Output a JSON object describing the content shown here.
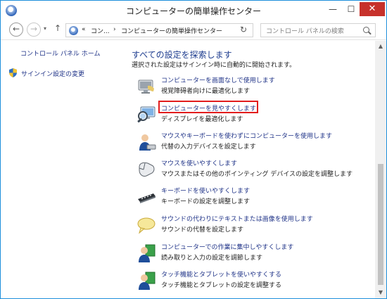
{
  "window": {
    "title": "コンピューターの簡単操作センター",
    "controls": {
      "minimize": "—",
      "maximize": "☐",
      "close": "✕"
    }
  },
  "toolbar": {
    "back": "←",
    "forward": "→",
    "history": "▾",
    "up": "↑",
    "address": {
      "overflow": "«",
      "segment1": "コン...",
      "separator": "›",
      "segment2": "コンピューターの簡単操作センター",
      "dropdown": "▾"
    },
    "refresh": "↻",
    "search_placeholder": "コントロール パネルの検索"
  },
  "left_pane": {
    "home_link": "コントロール パネル ホーム",
    "signin_link": "サインイン設定の変更"
  },
  "main": {
    "heading": "すべての設定を探索します",
    "subheading": "選択された設定はサインイン時に自動的に開始されます。",
    "items": [
      {
        "icon": "monitor-no-screen-icon",
        "link": "コンピューターを画面なしで使用します",
        "desc": "視覚障碍者向けに最適化します"
      },
      {
        "icon": "magnifier-monitor-icon",
        "link": "コンピューターを見やすくします",
        "desc": "ディスプレイを最適化します",
        "highlighted": true
      },
      {
        "icon": "user-keyboard-icon",
        "link": "マウスやキーボードを使わずにコンピューターを使用します",
        "desc": "代替の入力デバイスを設定します"
      },
      {
        "icon": "mouse-icon",
        "link": "マウスを使いやすくします",
        "desc": "マウスまたはその他のポインティング デバイスの設定を調整します"
      },
      {
        "icon": "keyboard-icon",
        "link": "キーボードを使いやすくします",
        "desc": "キーボードの設定を調整します"
      },
      {
        "icon": "speech-bubble-icon",
        "link": "サウンドの代わりにテキストまたは画像を使用します",
        "desc": "サウンドの代替を設定します"
      },
      {
        "icon": "user-focus-icon",
        "link": "コンピューターでの作業に集中しやすくします",
        "desc": "読み取りと入力の設定を調節します"
      },
      {
        "icon": "user-touch-icon",
        "link": "タッチ機能とタブレットを使いやすくする",
        "desc": "タッチ機能とタブレットの設定を調整する"
      }
    ]
  },
  "scrollbar": {
    "up": "▲",
    "down": "▼"
  },
  "colors": {
    "link": "#1e3287",
    "heading": "#1e3d8f",
    "highlight": "#e21d1d",
    "close": "#c7312b",
    "border": "#1e8fdc"
  }
}
